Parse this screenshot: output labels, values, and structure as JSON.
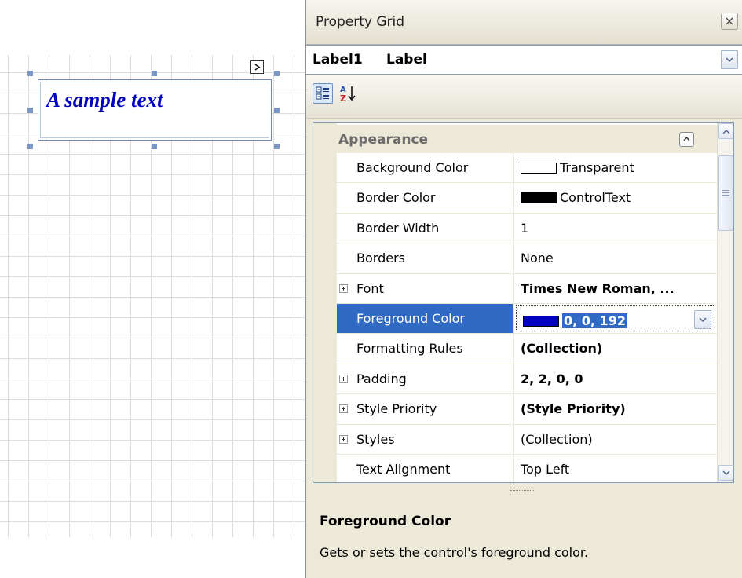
{
  "designer": {
    "label_text": "A sample text",
    "label_color": "#0000c0"
  },
  "property_grid": {
    "title": "Property Grid",
    "close_glyph": "×",
    "object_name": "Label1",
    "object_type": "Label",
    "toolbar": {
      "categorized_icon": "categorized-icon",
      "alphabetical_icon": "sort-alphabetical-icon"
    },
    "category": "Appearance",
    "rows": [
      {
        "name": "Background Color",
        "value": "Transparent",
        "swatch": "#ffffff",
        "bold": false,
        "expandable": false
      },
      {
        "name": "Border Color",
        "value": "ControlText",
        "swatch": "#000000",
        "bold": false,
        "expandable": false
      },
      {
        "name": "Border Width",
        "value": "1",
        "bold": false,
        "expandable": false
      },
      {
        "name": "Borders",
        "value": "None",
        "bold": false,
        "expandable": false
      },
      {
        "name": "Font",
        "value": "Times New Roman, ...",
        "bold": true,
        "expandable": true
      },
      {
        "name": "Foreground Color",
        "value": "0, 0, 192",
        "swatch": "#0000c0",
        "bold": true,
        "expandable": false,
        "selected": true
      },
      {
        "name": "Formatting Rules",
        "value": "(Collection)",
        "bold": true,
        "expandable": false
      },
      {
        "name": "Padding",
        "value": "2, 2, 0, 0",
        "bold": true,
        "expandable": true
      },
      {
        "name": "Style Priority",
        "value": "(Style Priority)",
        "bold": true,
        "expandable": true
      },
      {
        "name": "Styles",
        "value": "(Collection)",
        "bold": false,
        "expandable": true
      },
      {
        "name": "Text Alignment",
        "value": "Top Left",
        "bold": false,
        "expandable": false
      }
    ],
    "help": {
      "title": "Foreground Color",
      "description": "Gets or sets the control's foreground color."
    },
    "colors": {
      "selection": "#316ac5",
      "chrome": "#ece9d8"
    }
  }
}
